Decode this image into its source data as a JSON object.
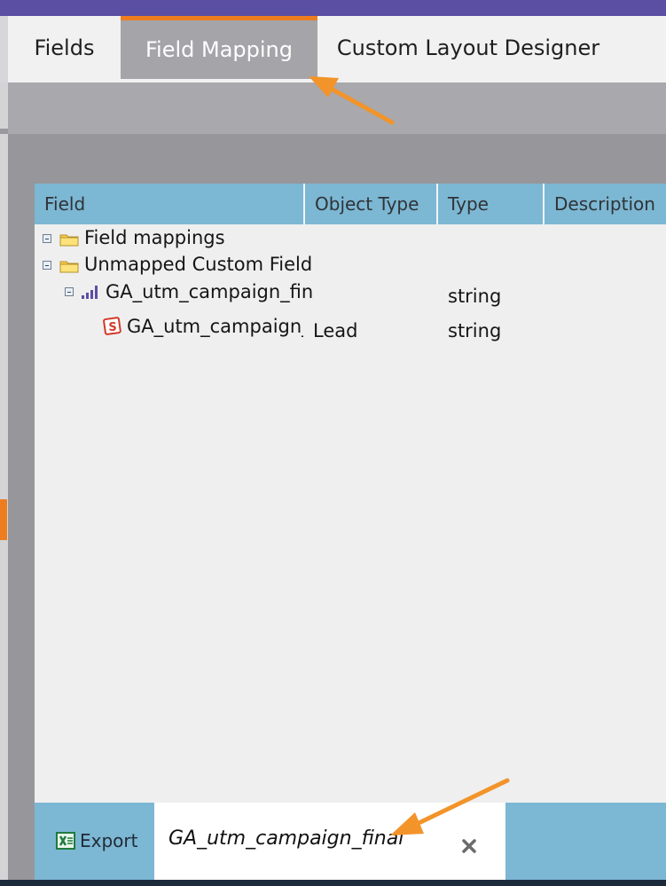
{
  "tabs": {
    "fields": "Fields",
    "field_mapping": "Field Mapping",
    "custom_layout_designer": "Custom Layout Designer"
  },
  "grid": {
    "columns": [
      "Field",
      "Object Type",
      "Type",
      "Description"
    ],
    "rows": [
      {
        "field": "Field mappings",
        "object_type": "",
        "type": "",
        "description": "",
        "icon": "folder-icon"
      },
      {
        "field": "Unmapped Custom Field",
        "object_type": "",
        "type": "",
        "description": "",
        "icon": "folder-icon"
      },
      {
        "field": "GA_utm_campaign_fin",
        "object_type": "",
        "type": "string",
        "description": "",
        "icon": "field-icon"
      },
      {
        "field": "GA_utm_campaign_",
        "object_type": "Lead",
        "type": "string",
        "description": "",
        "icon": "salesforce-lead-icon"
      }
    ]
  },
  "footer": {
    "export_label": "Export",
    "filter_value": "GA_utm_campaign_final"
  },
  "colors": {
    "top_bar": "#5b4fa3",
    "active_tab_accent": "#ed7d1f",
    "grid_header": "#7cb7d3",
    "annotation_arrow": "#f2942a"
  }
}
